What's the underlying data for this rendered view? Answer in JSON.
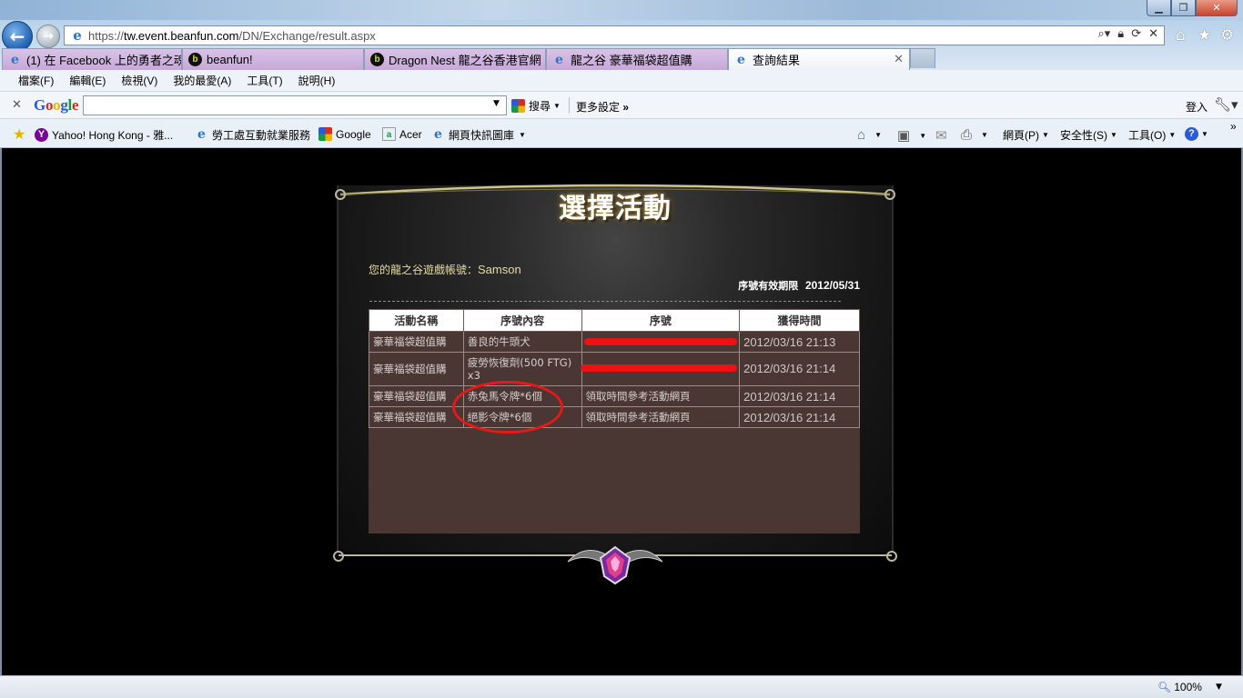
{
  "browser": {
    "url_scheme": "https://",
    "url_host": "tw.event.beanfun.com",
    "url_path": "/DN/Exchange/result.aspx",
    "tabs": [
      {
        "label": "(1) 在 Facebook 上的勇者之魂",
        "icon": "ie-icon"
      },
      {
        "label": "beanfun!",
        "icon": "beanfun-icon"
      },
      {
        "label": "Dragon Nest 龍之谷香港官網",
        "icon": "beanfun-icon"
      },
      {
        "label": "龍之谷 豪華福袋超值購",
        "icon": "ie-icon"
      },
      {
        "label": "查詢結果",
        "icon": "ie-icon"
      }
    ],
    "menu": [
      "檔案(F)",
      "編輯(E)",
      "檢視(V)",
      "我的最愛(A)",
      "工具(T)",
      "說明(H)"
    ],
    "google_toolbar": {
      "logo": [
        "G",
        "o",
        "o",
        "g",
        "l",
        "e"
      ],
      "search_value": "",
      "search_button": "搜尋",
      "more_settings": "更多設定",
      "login": "登入"
    },
    "favorites": [
      {
        "label": "Yahoo! Hong Kong - 雅...",
        "icon": "yahoo-icon"
      },
      {
        "label": "勞工處互動就業服務",
        "icon": "ie-icon"
      },
      {
        "label": "Google",
        "icon": "google-icon"
      },
      {
        "label": "Acer",
        "icon": "acer-icon"
      },
      {
        "label": "網頁快訊圖庫",
        "icon": "ie-icon"
      }
    ],
    "commands": {
      "page": "網頁(P)",
      "safety": "安全性(S)",
      "tools": "工具(O)"
    },
    "zoom": "100%"
  },
  "panel": {
    "title": "選擇活動",
    "account_prefix": "您的龍之谷遊戲帳號：",
    "account_name": "Samson",
    "expiry_label": "序號有效期限",
    "expiry_value": "2012/05/31",
    "table": {
      "headers": [
        "活動名稱",
        "序號內容",
        "序號",
        "獲得時間"
      ],
      "rows": [
        {
          "event": "豪華福袋超值購",
          "content": "善良的牛頭犬",
          "serial": "",
          "time": "2012/03/16 21:13"
        },
        {
          "event": "豪華福袋超值購",
          "content": "疲勞恢復劑(500 FTG) x3",
          "serial": "",
          "time": "2012/03/16 21:14"
        },
        {
          "event": "豪華福袋超值購",
          "content": "赤兔馬令牌*6個",
          "serial": "領取時間參考活動網頁",
          "time": "2012/03/16 21:14"
        },
        {
          "event": "豪華福袋超值購",
          "content": "絕影令牌*6個",
          "serial": "領取時間參考活動網頁",
          "time": "2012/03/16 21:14"
        }
      ]
    }
  },
  "colors": {
    "table_bg": "#4a3734",
    "redaction": "#ee1111",
    "title_glow": "#c8a24a",
    "account_text": "#e6dca6"
  }
}
